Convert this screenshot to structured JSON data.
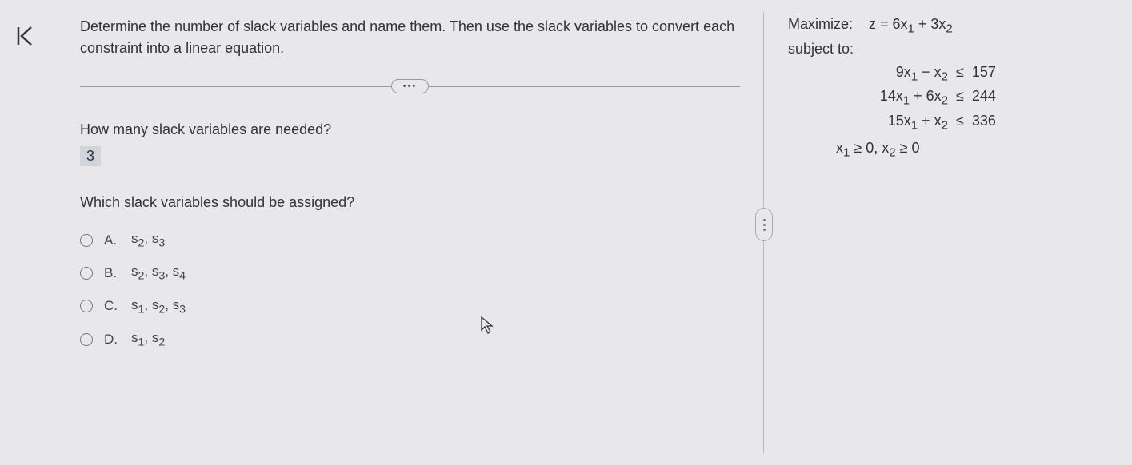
{
  "problem": {
    "instructions": "Determine the number of slack variables and name them. Then use the slack variables to convert each constraint into a linear equation.",
    "question1": "How many slack variables are needed?",
    "answer1": "3",
    "question2": "Which slack variables should be assigned?",
    "options": [
      {
        "letter": "A.",
        "text_html": "s<sub>2</sub>, s<sub>3</sub>"
      },
      {
        "letter": "B.",
        "text_html": "s<sub>2</sub>, s<sub>3</sub>, s<sub>4</sub>"
      },
      {
        "letter": "C.",
        "text_html": "s<sub>1</sub>, s<sub>2</sub>, s<sub>3</sub>"
      },
      {
        "letter": "D.",
        "text_html": "s<sub>1</sub>, s<sub>2</sub>"
      }
    ]
  },
  "lp": {
    "maximize_label": "Maximize:",
    "objective_html": "z = 6x<sub>1</sub> + 3x<sub>2</sub>",
    "subject_label": "subject to:",
    "constraints": [
      {
        "lhs_html": "9x<sub>1</sub> − x<sub>2</sub>",
        "op": "≤",
        "rhs": "157"
      },
      {
        "lhs_html": "14x<sub>1</sub> + 6x<sub>2</sub>",
        "op": "≤",
        "rhs": "244"
      },
      {
        "lhs_html": "15x<sub>1</sub> + x<sub>2</sub>",
        "op": "≤",
        "rhs": "336"
      }
    ],
    "nonneg_html": "x<sub>1</sub> ≥ 0, x<sub>2</sub> ≥ 0"
  },
  "ui": {
    "ellipsis": "•••"
  },
  "chart_data": {
    "type": "table",
    "title": "Linear Programming Problem",
    "objective": {
      "type": "maximize",
      "expression": "z = 6x1 + 3x2"
    },
    "constraints": [
      {
        "lhs": "9x1 - x2",
        "relation": "<=",
        "rhs": 157
      },
      {
        "lhs": "14x1 + 6x2",
        "relation": "<=",
        "rhs": 244
      },
      {
        "lhs": "15x1 + x2",
        "relation": "<=",
        "rhs": 336
      }
    ],
    "nonnegativity": [
      "x1 >= 0",
      "x2 >= 0"
    ],
    "slack_count_answer": 3,
    "choices": [
      "s2, s3",
      "s2, s3, s4",
      "s1, s2, s3",
      "s1, s2"
    ]
  }
}
